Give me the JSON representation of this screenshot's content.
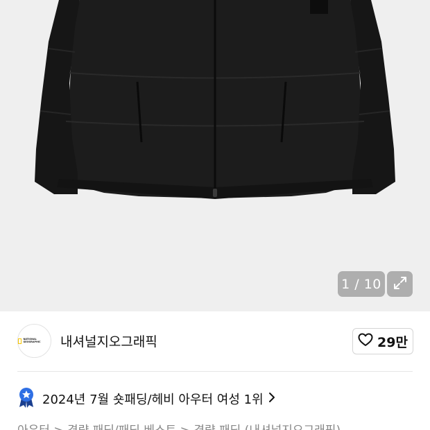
{
  "gallery": {
    "counter": "1 / 10",
    "image_icon": "black-puffer-jacket-photo",
    "expand_icon": "expand-arrows-icon"
  },
  "brand": {
    "name": "내셔널지오그래픽",
    "logo_text": "NATIONAL GEOGRAPHIC",
    "likes": "29만",
    "like_icon": "heart-outline-icon"
  },
  "ranking": {
    "text": "2024년 7월 숏패딩/헤비 아우터 여성 1위",
    "badge_icon": "blue-star-medal-icon",
    "badge_color": "#2f6fe4"
  },
  "breadcrumb": {
    "text": "아우터 > 경량 패딩/패딩 베스트 > 경량 패딩 (내셔널지오그래픽)"
  }
}
